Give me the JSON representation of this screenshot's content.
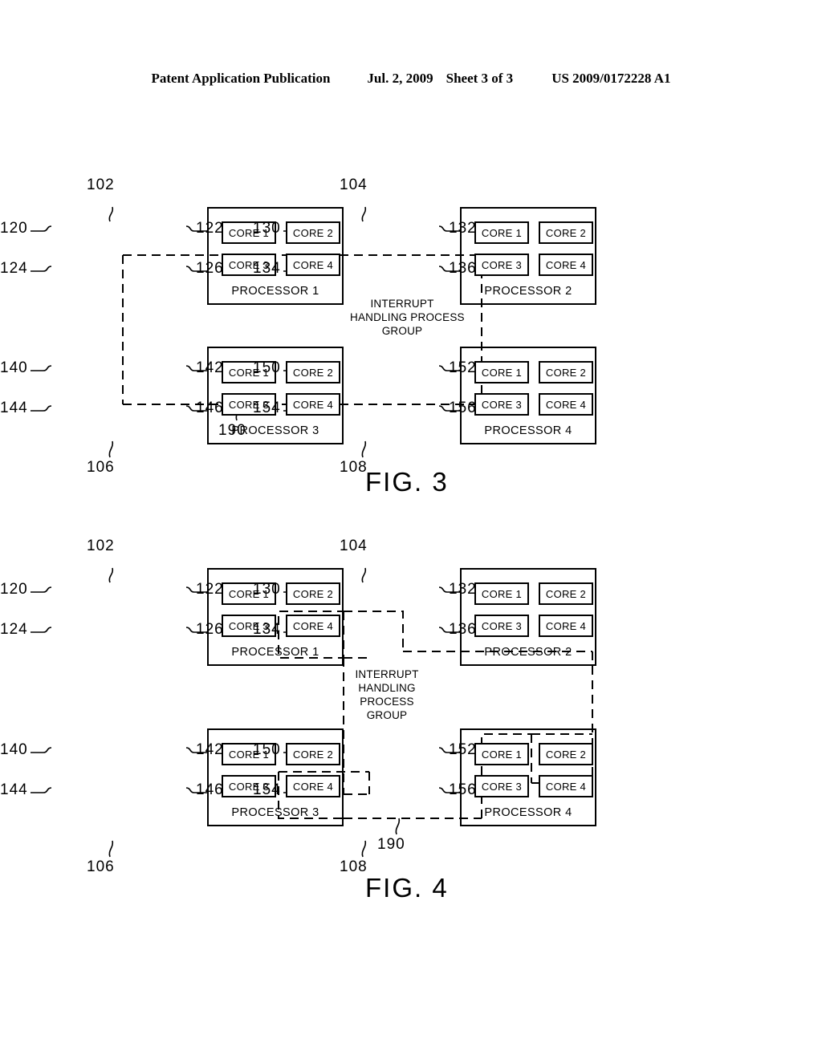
{
  "header": {
    "publication": "Patent Application Publication",
    "date": "Jul. 2, 2009",
    "sheet": "Sheet 3 of 3",
    "patent_number": "US 2009/0172228 A1"
  },
  "core_labels": {
    "core1": "CORE 1",
    "core2": "CORE 2",
    "core3": "CORE 3",
    "core4": "CORE 4"
  },
  "figures": [
    {
      "id": "fig3",
      "caption": "FIG. 3",
      "group_caption": [
        "INTERRUPT",
        "HANDLING PROCESS",
        "GROUP"
      ],
      "group_ref": "190",
      "processors": [
        {
          "name": "PROCESSOR 1",
          "ref": "102",
          "ref_position": "top",
          "cores": [
            {
              "label": "CORE 1",
              "ref": "120",
              "ref_side": "left"
            },
            {
              "label": "CORE 2",
              "ref": "122",
              "ref_side": "right"
            },
            {
              "label": "CORE 3",
              "ref": "124",
              "ref_side": "left"
            },
            {
              "label": "CORE 4",
              "ref": "126",
              "ref_side": "right"
            }
          ]
        },
        {
          "name": "PROCESSOR 2",
          "ref": "104",
          "ref_position": "top",
          "cores": [
            {
              "label": "CORE 1",
              "ref": "130",
              "ref_side": "left"
            },
            {
              "label": "CORE 2",
              "ref": "132",
              "ref_side": "right"
            },
            {
              "label": "CORE 3",
              "ref": "134",
              "ref_side": "left"
            },
            {
              "label": "CORE 4",
              "ref": "136",
              "ref_side": "right"
            }
          ]
        },
        {
          "name": "PROCESSOR 3",
          "ref": "106",
          "ref_position": "bottom",
          "cores": [
            {
              "label": "CORE 1",
              "ref": "140",
              "ref_side": "left"
            },
            {
              "label": "CORE 2",
              "ref": "142",
              "ref_side": "right"
            },
            {
              "label": "CORE 3",
              "ref": "144",
              "ref_side": "left"
            },
            {
              "label": "CORE 4",
              "ref": "146",
              "ref_side": "right"
            }
          ]
        },
        {
          "name": "PROCESSOR 4",
          "ref": "108",
          "ref_position": "bottom",
          "cores": [
            {
              "label": "CORE 1",
              "ref": "150",
              "ref_side": "left"
            },
            {
              "label": "CORE 2",
              "ref": "152",
              "ref_side": "right"
            },
            {
              "label": "CORE 3",
              "ref": "154",
              "ref_side": "left"
            },
            {
              "label": "CORE 4",
              "ref": "156",
              "ref_side": "right"
            }
          ]
        }
      ]
    },
    {
      "id": "fig4",
      "caption": "FIG. 4",
      "group_caption": [
        "INTERRUPT",
        "HANDLING",
        "PROCESS",
        "GROUP"
      ],
      "group_ref": "190",
      "processors": [
        {
          "name": "PROCESSOR 1",
          "ref": "102",
          "ref_position": "top",
          "cores": [
            {
              "label": "CORE 1",
              "ref": "120",
              "ref_side": "left"
            },
            {
              "label": "CORE 2",
              "ref": "122",
              "ref_side": "right"
            },
            {
              "label": "CORE 3",
              "ref": "124",
              "ref_side": "left"
            },
            {
              "label": "CORE 4",
              "ref": "126",
              "ref_side": "right"
            }
          ]
        },
        {
          "name": "PROCESSOR 2",
          "ref": "104",
          "ref_position": "top",
          "cores": [
            {
              "label": "CORE 1",
              "ref": "130",
              "ref_side": "left"
            },
            {
              "label": "CORE 2",
              "ref": "132",
              "ref_side": "right"
            },
            {
              "label": "CORE 3",
              "ref": "134",
              "ref_side": "left"
            },
            {
              "label": "CORE 4",
              "ref": "136",
              "ref_side": "right"
            }
          ]
        },
        {
          "name": "PROCESSOR 3",
          "ref": "106",
          "ref_position": "bottom",
          "cores": [
            {
              "label": "CORE 1",
              "ref": "140",
              "ref_side": "left"
            },
            {
              "label": "CORE 2",
              "ref": "142",
              "ref_side": "right"
            },
            {
              "label": "CORE 3",
              "ref": "144",
              "ref_side": "left"
            },
            {
              "label": "CORE 4",
              "ref": "146",
              "ref_side": "right"
            }
          ]
        },
        {
          "name": "PROCESSOR 4",
          "ref": "108",
          "ref_position": "bottom",
          "cores": [
            {
              "label": "CORE 1",
              "ref": "150",
              "ref_side": "left"
            },
            {
              "label": "CORE 2",
              "ref": "152",
              "ref_side": "right"
            },
            {
              "label": "CORE 3",
              "ref": "154",
              "ref_side": "left"
            },
            {
              "label": "CORE 4",
              "ref": "156",
              "ref_side": "right"
            }
          ]
        }
      ]
    }
  ]
}
